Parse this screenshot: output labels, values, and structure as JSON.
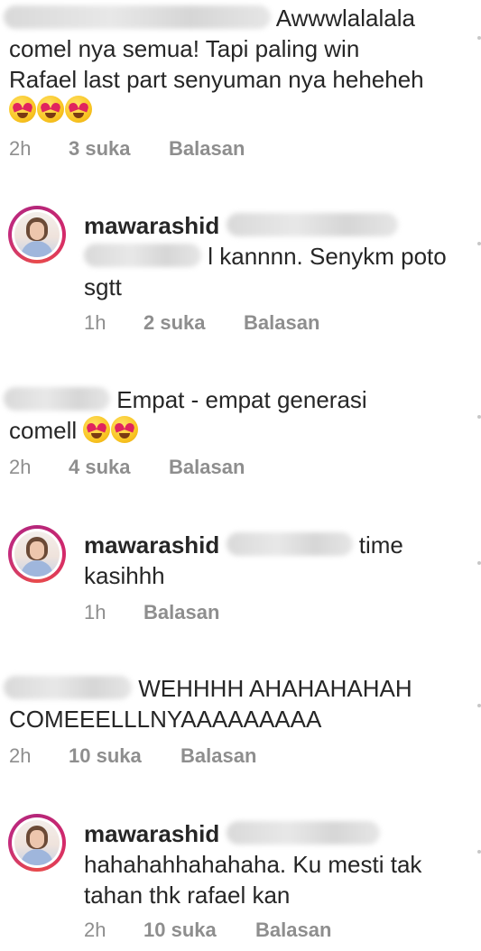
{
  "comments": [
    {
      "text_line1": "Awwwlalalala",
      "text_rest1": "comel nya semua! Tapi paling win",
      "text_rest2": "Rafael last part senyuman nya heheheh",
      "emoji_count": 3,
      "time": "2h",
      "likes": "3 suka",
      "reply": "Balasan"
    },
    {
      "username": "mawarashid",
      "text_line1": "l kannnn. Senykm poto",
      "text_rest1": "sgtt",
      "time": "1h",
      "likes": "2 suka",
      "reply": "Balasan"
    },
    {
      "text_line1": "Empat - empat generasi",
      "text_rest1": "comell",
      "emoji_count": 2,
      "time": "2h",
      "likes": "4 suka",
      "reply": "Balasan"
    },
    {
      "username": "mawarashid",
      "text_line1": "time",
      "text_rest1": "kasihhh",
      "time": "1h",
      "reply": "Balasan"
    },
    {
      "text_line1": "WEHHHH AHAHAHAHAH",
      "text_rest1": "COMEEELLLNYAAAAAAAAA",
      "time": "2h",
      "likes": "10 suka",
      "reply": "Balasan"
    },
    {
      "username": "mawarashid",
      "text_line1": "hahahahhahahaha. Ku mesti tak",
      "text_rest1": "tahan thk rafael kan",
      "time": "2h",
      "likes": "10 suka",
      "reply": "Balasan"
    }
  ],
  "icons": {
    "emoji": "smiling-face-with-heart-eyes-emoji",
    "avatar": "profile-avatar-icon"
  },
  "colors": {
    "text": "#262626",
    "meta": "#8e8e8e",
    "ring": "#c42b7d"
  }
}
